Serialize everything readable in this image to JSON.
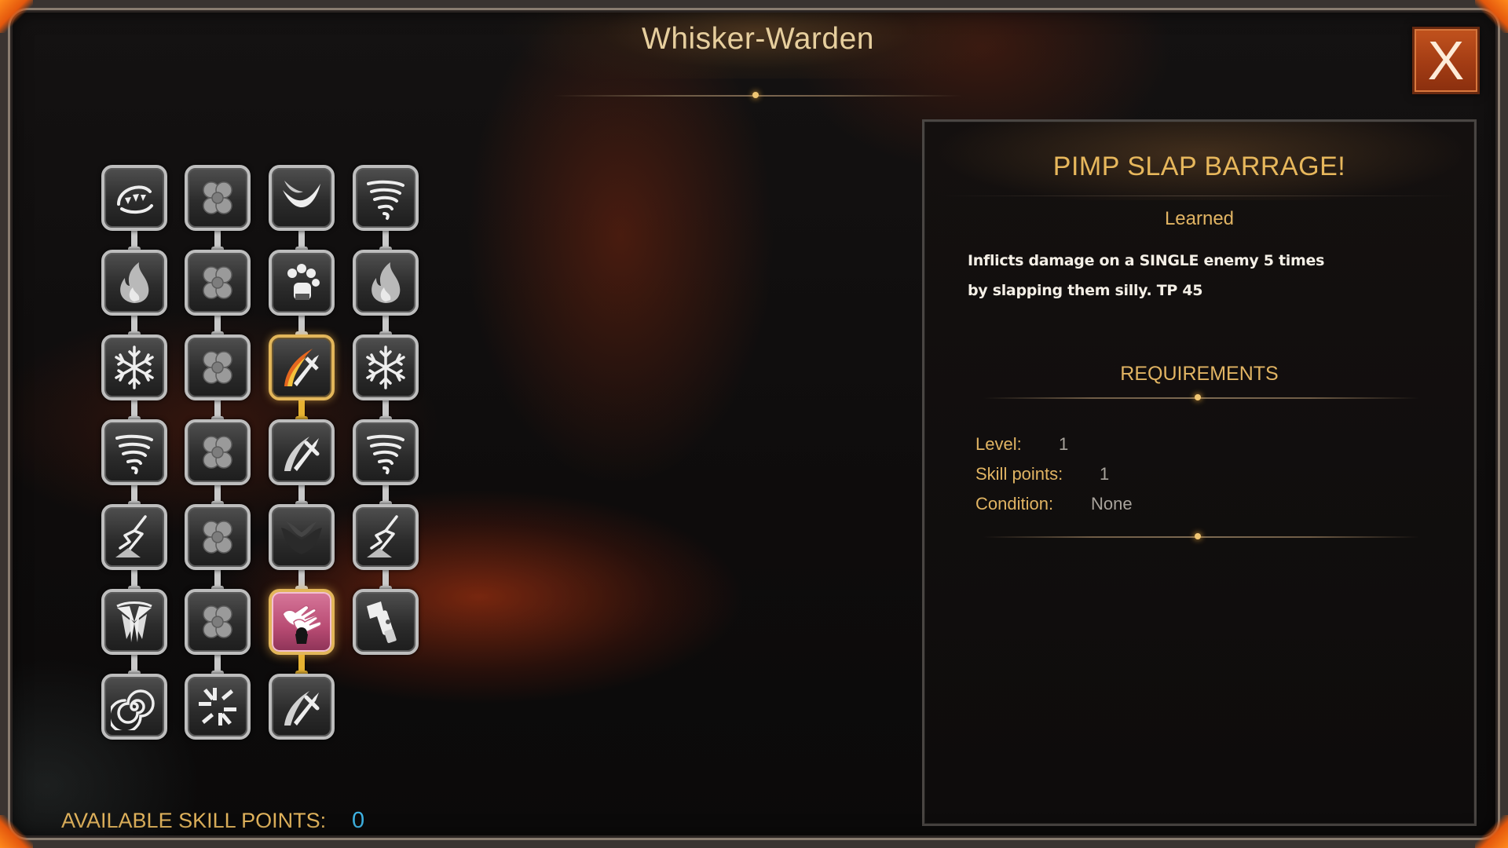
{
  "window": {
    "title": "Whisker-Warden",
    "close_label": "X"
  },
  "skill_tree": {
    "icons": [
      [
        "bite-icon",
        "clover-icon",
        "claw-swipe-icon",
        "tornado-icon"
      ],
      [
        "flame-icon",
        "clover-icon",
        "paw-glove-icon",
        "flame-icon"
      ],
      [
        "snowflake-icon",
        "clover-icon",
        "fire-sword-icon",
        "snowflake-icon"
      ],
      [
        "tornado-icon",
        "clover-icon",
        "sword-icon",
        "tornado-icon"
      ],
      [
        "lightning-icon",
        "clover-icon",
        "bat-icon",
        "lightning-icon"
      ],
      [
        "radiant-burst-icon",
        "clover-icon",
        "slap-hands-icon",
        "flashlight-icon"
      ],
      [
        "spiral-icon",
        "shatter-icon",
        "sword-icon",
        null
      ]
    ],
    "learned": [
      "2-2",
      "5-2"
    ],
    "selected": "5-2"
  },
  "details": {
    "name": "PIMP SLAP BARRAGE!",
    "status": "Learned",
    "description_line1": "Inflicts damage on a SINGLE enemy 5 times",
    "description_line2": "by slapping them silly. TP 45",
    "requirements_title": "REQUIREMENTS",
    "requirements": {
      "level_label": "Level:",
      "level_value": "1",
      "skill_points_label": "Skill points:",
      "skill_points_value": "1",
      "condition_label": "Condition:",
      "condition_value": "None"
    }
  },
  "footer": {
    "available_label": "AVAILABLE SKILL POINTS:",
    "available_value": "0"
  },
  "colors": {
    "accent_gold": "#e1b463",
    "points_blue": "#3fb5e6",
    "close_orange": "#b4471a"
  }
}
